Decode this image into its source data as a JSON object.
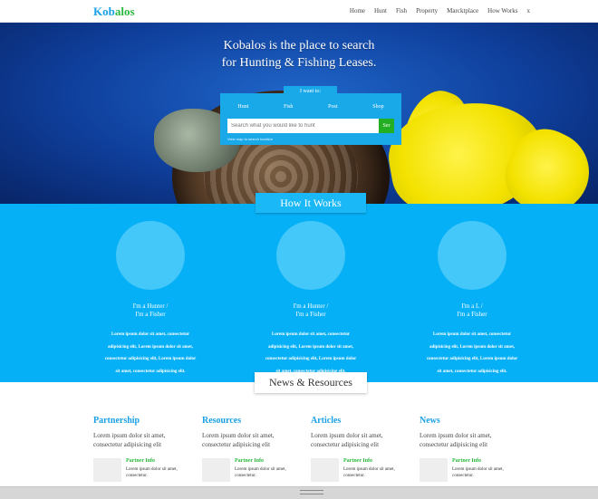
{
  "brand": {
    "logo_part1": "Kob",
    "logo_part2": "alos",
    "logo_color1": "#1aa0e6",
    "logo_color2": "#2ab83e"
  },
  "nav": {
    "items": [
      "Home",
      "Hunt",
      "Fish",
      "Property",
      "Marcktplace",
      "How Works",
      "x"
    ]
  },
  "hero": {
    "title_line1": "Kobalos is the place to search",
    "title_line2": "for Hunting & Fishing Leases.",
    "search": {
      "tab_label": "I want to:",
      "options": [
        "Hunt",
        "Fish",
        "Post",
        "Shop"
      ],
      "placeholder": "Search what you would like to hunt",
      "button": "Ser",
      "hint": "View map to search location"
    }
  },
  "how_it_works": {
    "title": "How It Works",
    "steps": [
      {
        "label_line1": "I'm a Hunter /",
        "label_line2": "I'm a Fisher",
        "desc": [
          "Lorem ipsum dolor sit amet, consectetur",
          "adipisicing elit, Lorem ipsum dolor sit amet,",
          "consectetur adipisicing elit, Lorem ipsum dolor",
          "sit amet, consectetur adipisicing elit."
        ]
      },
      {
        "label_line1": "I'm a Hunter /",
        "label_line2": "I'm a Fisher",
        "desc": [
          "Lorem ipsum dolor sit amet, consectetur",
          "adipisicing elit, Lorem ipsum dolor sit amet,",
          "consectetur adipisicing elit, Lorem ipsum dolor",
          "sit amet, consectetur adipisicing elit."
        ]
      },
      {
        "label_line1": "I'm a L /",
        "label_line2": "I'm a Fisher",
        "desc": [
          "Lorem ipsum dolor sit amet, consectetur",
          "adipisicing elit, Lorem ipsum dolor sit amet,",
          "consectetur adipisicing elit, Lorem ipsum dolor",
          "sit amet, consectetur adipisicing elit."
        ]
      }
    ]
  },
  "news": {
    "title": "News & Resources",
    "columns": [
      {
        "heading": "Partnership",
        "text": "Lorem ipsum dolor sit amet, consectetur adipisicing elit",
        "partner_title": "Partner Info",
        "partner_text": "Lorem ipsum dolor sit amet, consectetur."
      },
      {
        "heading": "Resources",
        "text": "Lorem ipsum dolor sit amet, consectetur adipisicing elit",
        "partner_title": "Partner Info",
        "partner_text": "Lorem ipsum dolor sit amet, consectetur."
      },
      {
        "heading": "Articles",
        "text": "Lorem ipsum dolor sit amet, consectetur adipisicing elit",
        "partner_title": "Partner Info",
        "partner_text": "Lorem ipsum dolor sit amet, consectetur."
      },
      {
        "heading": "News",
        "text": "Lorem ipsum dolor sit amet, consectetur adipisicing elit",
        "partner_title": "Partner Info",
        "partner_text": "Lorem ipsum dolor sit amet, consectetur."
      }
    ]
  },
  "colors": {
    "primary_blue": "#06b0f6",
    "accent_green": "#22b022",
    "link_blue": "#1aa0e6"
  }
}
